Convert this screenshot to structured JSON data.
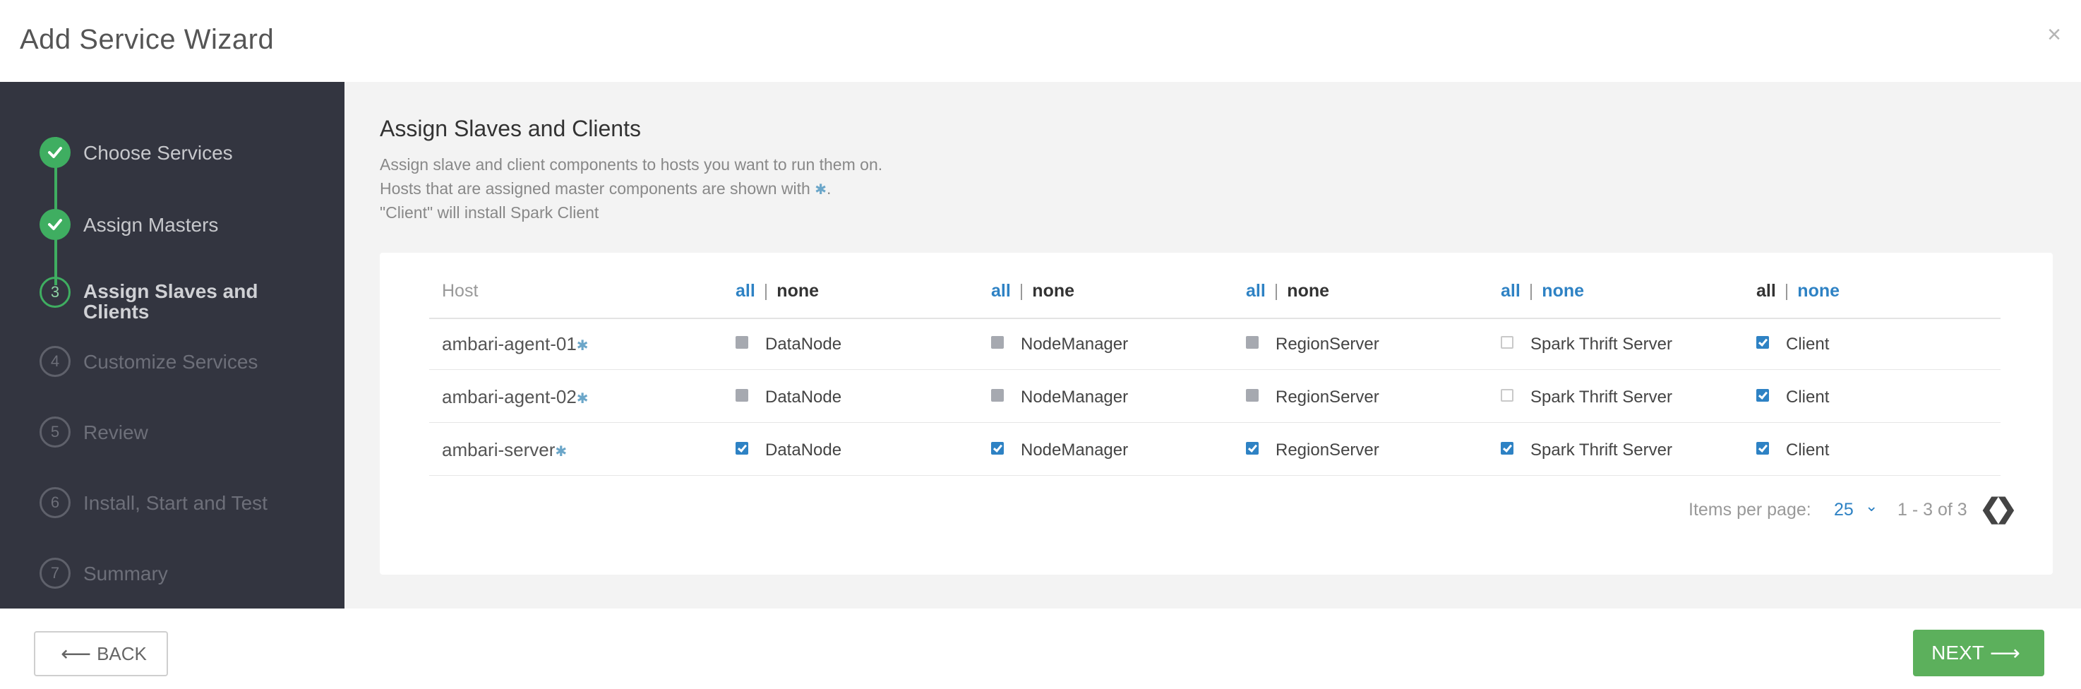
{
  "window": {
    "title": "Add Service Wizard",
    "close_glyph": "×"
  },
  "steps": [
    {
      "label": "Choose Services",
      "state": "done",
      "num": "1"
    },
    {
      "label": "Assign Masters",
      "state": "done",
      "num": "2"
    },
    {
      "label": "Assign Slaves and Clients",
      "state": "current",
      "num": "3"
    },
    {
      "label": "Customize Services",
      "state": "todo",
      "num": "4"
    },
    {
      "label": "Review",
      "state": "todo",
      "num": "5"
    },
    {
      "label": "Install, Start and Test",
      "state": "todo",
      "num": "6"
    },
    {
      "label": "Summary",
      "state": "todo",
      "num": "7"
    }
  ],
  "main": {
    "title": "Assign Slaves and Clients",
    "desc1": "Assign slave and client components to hosts you want to run them on.",
    "desc2_prefix": "Hosts that are assigned master components are shown with",
    "desc2_suffix": ".",
    "desc3": "\"Client\" will install Spark Client",
    "master_glyph": "✱"
  },
  "table": {
    "host_header": "Host",
    "all_label": "all",
    "none_label": "none",
    "sep": "|",
    "columns": [
      "DataNode",
      "NodeManager",
      "RegionServer",
      "Spark Thrift Server",
      "Client"
    ],
    "rows": [
      {
        "host": "ambari-agent-01",
        "states": [
          "disabled",
          "disabled",
          "disabled",
          "unchecked",
          "checked"
        ]
      },
      {
        "host": "ambari-agent-02",
        "states": [
          "disabled",
          "disabled",
          "disabled",
          "unchecked",
          "checked"
        ]
      },
      {
        "host": "ambari-server",
        "states": [
          "checked",
          "checked",
          "checked",
          "checked",
          "checked"
        ]
      }
    ]
  },
  "pagination": {
    "items_per_page_label": "Items per page:",
    "items_per_page_value": "25",
    "range": "1 - 3 of 3",
    "prev_glyph": "❮",
    "next_glyph": "❯",
    "dropdown_glyph": "⌄"
  },
  "footer": {
    "back_label": "BACK",
    "back_arrow": "⟵",
    "next_label": "NEXT",
    "next_arrow": "⟶"
  },
  "colors": {
    "sidebar": "#333540",
    "step_done": "#3fae61",
    "link": "#2e82c4",
    "next_button": "#5cb05c"
  }
}
